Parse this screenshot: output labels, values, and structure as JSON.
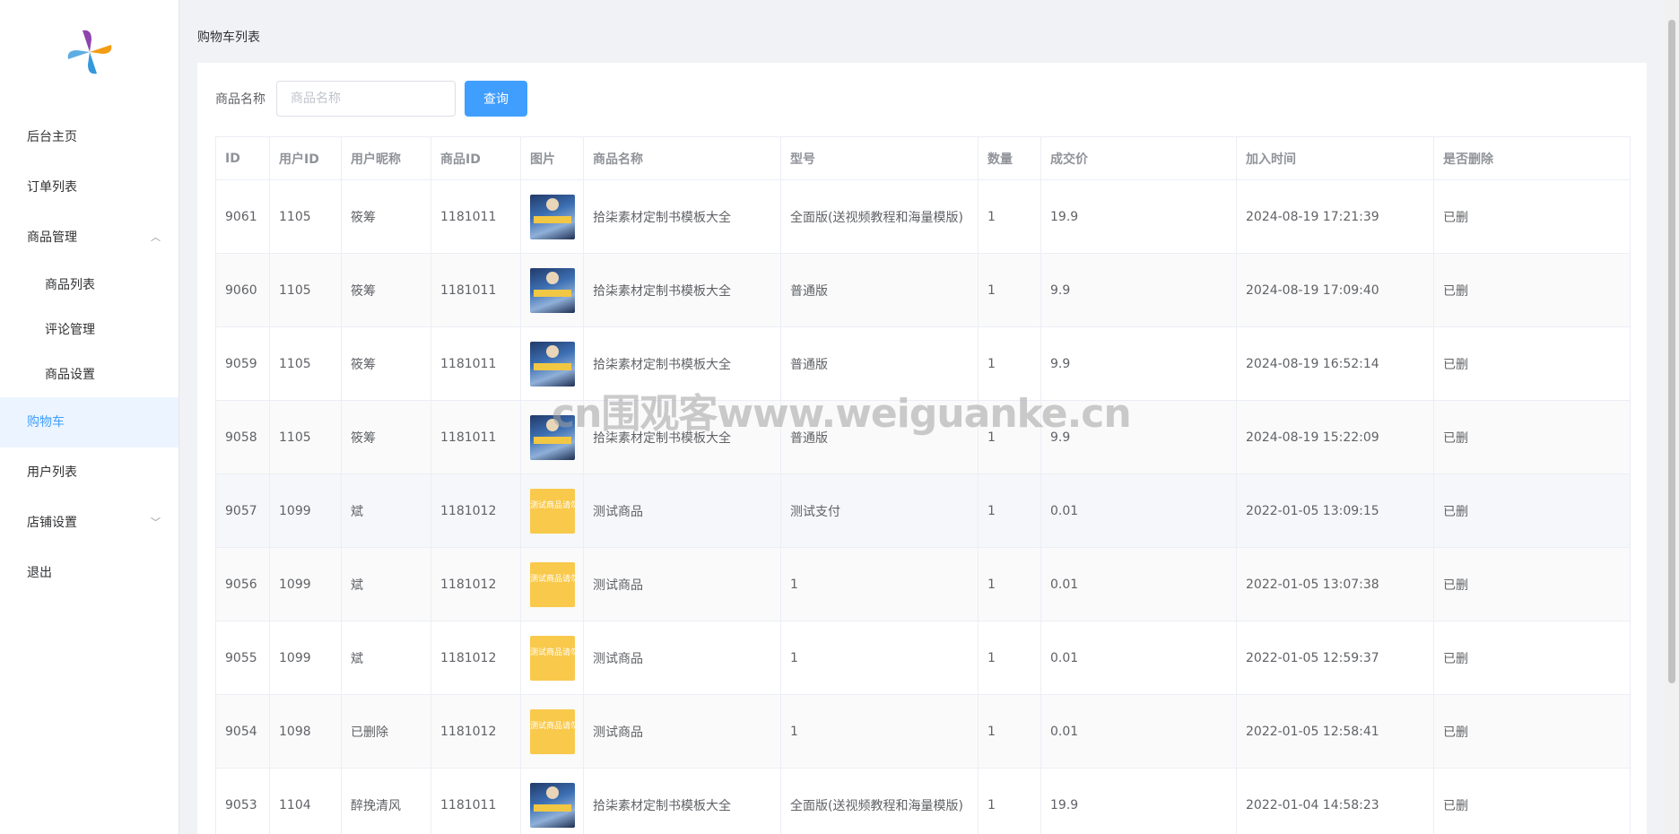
{
  "sidebar": {
    "items": [
      {
        "label": "后台主页"
      },
      {
        "label": "订单列表"
      },
      {
        "label": "商品管理",
        "children": [
          {
            "label": "商品列表"
          },
          {
            "label": "评论管理"
          },
          {
            "label": "商品设置"
          }
        ]
      },
      {
        "label": "购物车",
        "active": true
      },
      {
        "label": "用户列表"
      },
      {
        "label": "店铺设置"
      },
      {
        "label": "退出"
      }
    ]
  },
  "breadcrumb": "购物车列表",
  "search": {
    "label": "商品名称",
    "placeholder": "商品名称",
    "button": "查询"
  },
  "table": {
    "headers": [
      "ID",
      "用户ID",
      "用户昵称",
      "商品ID",
      "图片",
      "商品名称",
      "型号",
      "数量",
      "成交价",
      "加入时间",
      "是否删除"
    ],
    "rows": [
      {
        "id": "9061",
        "uid": "1105",
        "nick": "筱筹",
        "pid": "1181011",
        "img": "poster",
        "name": "拾柒素材定制书模板大全",
        "model": "全面版(送视频教程和海量模版)",
        "qty": "1",
        "price": "19.9",
        "time": "2024-08-19 17:21:39",
        "deleted": "已删"
      },
      {
        "id": "9060",
        "uid": "1105",
        "nick": "筱筹",
        "pid": "1181011",
        "img": "poster",
        "name": "拾柒素材定制书模板大全",
        "model": "普通版",
        "qty": "1",
        "price": "9.9",
        "time": "2024-08-19 17:09:40",
        "deleted": "已删"
      },
      {
        "id": "9059",
        "uid": "1105",
        "nick": "筱筹",
        "pid": "1181011",
        "img": "poster",
        "name": "拾柒素材定制书模板大全",
        "model": "普通版",
        "qty": "1",
        "price": "9.9",
        "time": "2024-08-19 16:52:14",
        "deleted": "已删"
      },
      {
        "id": "9058",
        "uid": "1105",
        "nick": "筱筹",
        "pid": "1181011",
        "img": "poster",
        "name": "拾柒素材定制书模板大全",
        "model": "普通版",
        "qty": "1",
        "price": "9.9",
        "time": "2024-08-19 15:22:09",
        "deleted": "已删"
      },
      {
        "id": "9057",
        "uid": "1099",
        "nick": "斌",
        "pid": "1181012",
        "img": "test",
        "name": "测试商品",
        "model": "测试支付",
        "qty": "1",
        "price": "0.01",
        "time": "2022-01-05 13:09:15",
        "deleted": "已删"
      },
      {
        "id": "9056",
        "uid": "1099",
        "nick": "斌",
        "pid": "1181012",
        "img": "test",
        "name": "测试商品",
        "model": "1",
        "qty": "1",
        "price": "0.01",
        "time": "2022-01-05 13:07:38",
        "deleted": "已删"
      },
      {
        "id": "9055",
        "uid": "1099",
        "nick": "斌",
        "pid": "1181012",
        "img": "test",
        "name": "测试商品",
        "model": "1",
        "qty": "1",
        "price": "0.01",
        "time": "2022-01-05 12:59:37",
        "deleted": "已删"
      },
      {
        "id": "9054",
        "uid": "1098",
        "nick": "已删除",
        "pid": "1181012",
        "img": "test",
        "name": "测试商品",
        "model": "1",
        "qty": "1",
        "price": "0.01",
        "time": "2022-01-05 12:58:41",
        "deleted": "已删"
      },
      {
        "id": "9053",
        "uid": "1104",
        "nick": "醉挽清风",
        "pid": "1181011",
        "img": "poster",
        "name": "拾柒素材定制书模板大全",
        "model": "全面版(送视频教程和海量模版)",
        "qty": "1",
        "price": "19.9",
        "time": "2022-01-04 14:58:23",
        "deleted": "已删"
      }
    ]
  },
  "test_image_text": "测试商品请勿乱拍",
  "watermark": "cn围观客www.weiguanke.cn",
  "colors": {
    "primary": "#409eff",
    "active_bg": "#ecf5ff"
  }
}
